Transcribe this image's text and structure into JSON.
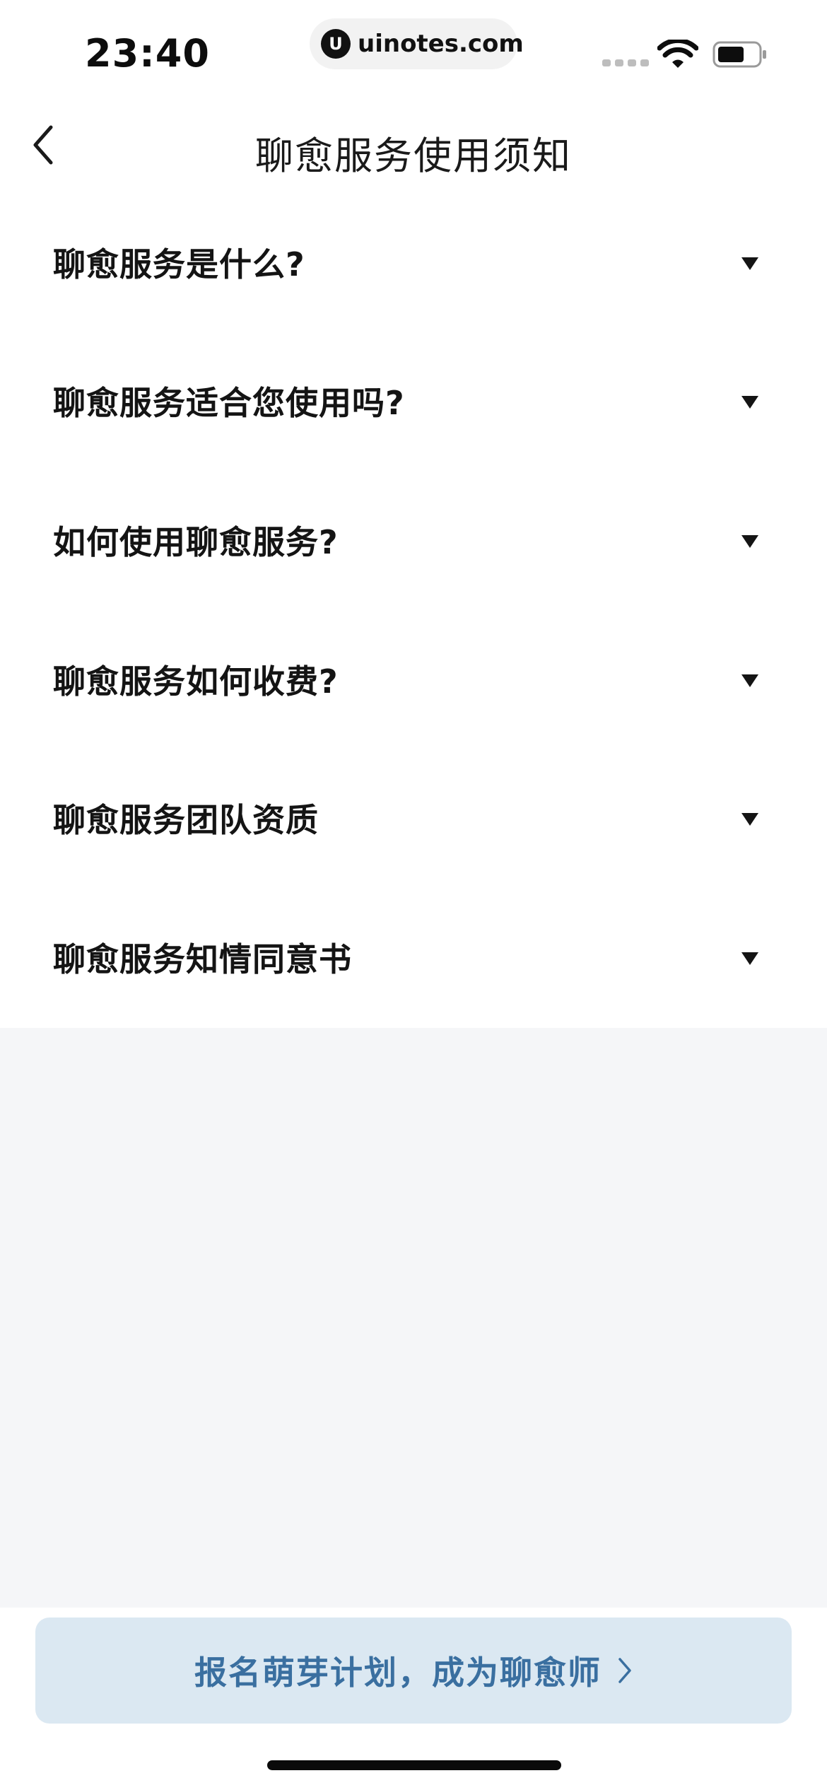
{
  "status_bar": {
    "time": "23:40",
    "url": "uinotes.com",
    "logo_glyph": "U",
    "icons": [
      "signal-icon",
      "wifi-icon",
      "battery-icon"
    ]
  },
  "nav": {
    "title": "聊愈服务使用须知",
    "back_icon": "chevron-left-icon"
  },
  "faq": [
    {
      "label": "聊愈服务是什么?"
    },
    {
      "label": "聊愈服务适合您使用吗?"
    },
    {
      "label": "如何使用聊愈服务?"
    },
    {
      "label": "聊愈服务如何收费?"
    },
    {
      "label": "聊愈服务团队资质"
    },
    {
      "label": "聊愈服务知情同意书"
    }
  ],
  "cta": {
    "label": "报名萌芽计划，成为聊愈师",
    "icon": "chevron-right-icon"
  },
  "colors": {
    "cta_bg": "#dbe8f2",
    "cta_text": "#3a6fa0",
    "page_bg": "#f5f6f8"
  }
}
